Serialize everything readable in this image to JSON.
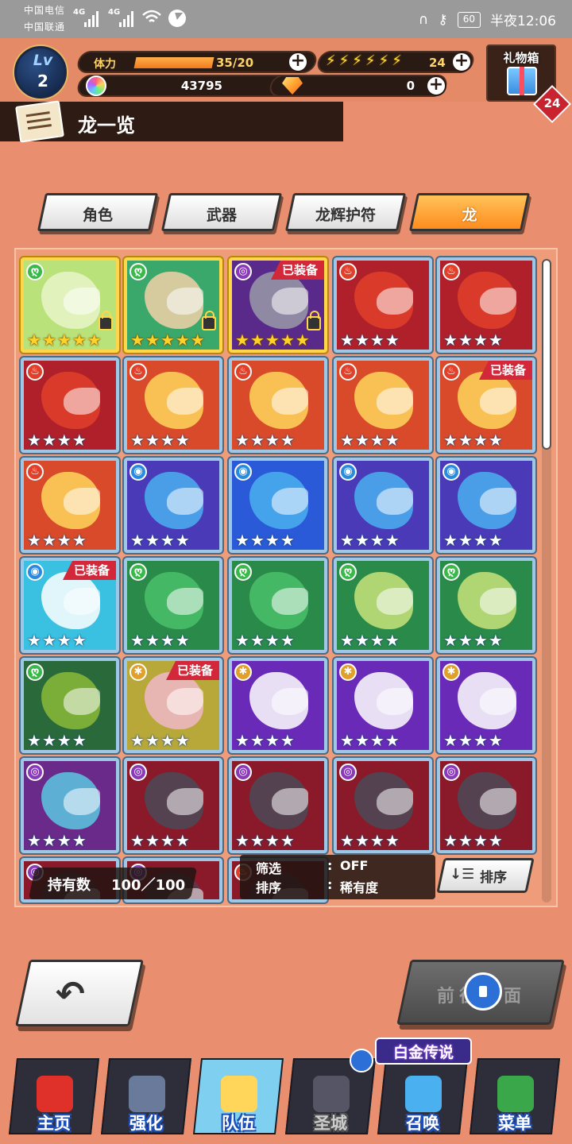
{
  "status_bar": {
    "carrier1": "中国电信",
    "carrier2": "中国联通",
    "net1": "4G",
    "net2": "4G",
    "battery": "60",
    "time": "半夜12:06"
  },
  "hud": {
    "level_label": "Lv",
    "level": "2",
    "stamina_label": "体力",
    "stamina": "35/20",
    "stamina_fill": 1.0,
    "bolts": [
      "⚡",
      "⚡",
      "⚡",
      "⚡",
      "⚡",
      "⚡"
    ],
    "bolt_count": "24",
    "gems": "43795",
    "crystals": "0",
    "gift_label": "礼物箱",
    "gift_count": "24"
  },
  "title": "龙一览",
  "tabs": [
    {
      "label": "角色",
      "active": false
    },
    {
      "label": "武器",
      "active": false
    },
    {
      "label": "龙辉护符",
      "active": false
    },
    {
      "label": "龙",
      "active": true
    }
  ],
  "grid": [
    {
      "element": "wind",
      "color": "#b9e27a",
      "art": "#e8f5c8",
      "stars": 5,
      "gold": true,
      "locked": true,
      "equipped": false
    },
    {
      "element": "wind",
      "color": "#3aa86a",
      "art": "#f1d1a8",
      "stars": 5,
      "gold": true,
      "locked": true,
      "equipped": false
    },
    {
      "element": "dark",
      "color": "#5a2a8a",
      "art": "#9a9aa8",
      "stars": 5,
      "gold": true,
      "locked": true,
      "equipped": true
    },
    {
      "element": "fire",
      "color": "#b0202a",
      "art": "#e0402a",
      "stars": 4,
      "gold": false,
      "locked": false,
      "equipped": false
    },
    {
      "element": "fire",
      "color": "#b0202a",
      "art": "#e0402a",
      "stars": 4,
      "gold": false,
      "locked": false,
      "equipped": false
    },
    {
      "element": "fire",
      "color": "#b0202a",
      "art": "#e0402a",
      "stars": 4,
      "gold": false,
      "locked": false,
      "equipped": false
    },
    {
      "element": "fire",
      "color": "#d84a2a",
      "art": "#ffd65a",
      "stars": 4,
      "gold": false,
      "locked": false,
      "equipped": false
    },
    {
      "element": "fire",
      "color": "#d84a2a",
      "art": "#ffd65a",
      "stars": 4,
      "gold": false,
      "locked": false,
      "equipped": false
    },
    {
      "element": "fire",
      "color": "#d84a2a",
      "art": "#ffd65a",
      "stars": 4,
      "gold": false,
      "locked": false,
      "equipped": false
    },
    {
      "element": "fire",
      "color": "#d84a2a",
      "art": "#ffd65a",
      "stars": 4,
      "gold": false,
      "locked": false,
      "equipped": true
    },
    {
      "element": "fire",
      "color": "#d84a2a",
      "art": "#ffd65a",
      "stars": 4,
      "gold": false,
      "locked": false,
      "equipped": false
    },
    {
      "element": "water",
      "color": "#4a3ab8",
      "art": "#4ab0f0",
      "stars": 4,
      "gold": false,
      "locked": false,
      "equipped": false
    },
    {
      "element": "water",
      "color": "#2a5ad8",
      "art": "#4ab0f0",
      "stars": 4,
      "gold": false,
      "locked": false,
      "equipped": false
    },
    {
      "element": "water",
      "color": "#4a3ab8",
      "art": "#4ab0f0",
      "stars": 4,
      "gold": false,
      "locked": false,
      "equipped": false
    },
    {
      "element": "water",
      "color": "#4a3ab8",
      "art": "#4ab0f0",
      "stars": 4,
      "gold": false,
      "locked": false,
      "equipped": false
    },
    {
      "element": "water",
      "color": "#3ac0e0",
      "art": "#ffffff",
      "stars": 4,
      "gold": false,
      "locked": false,
      "equipped": true
    },
    {
      "element": "wind",
      "color": "#2a8a4a",
      "art": "#4ac06a",
      "stars": 4,
      "gold": false,
      "locked": false,
      "equipped": false
    },
    {
      "element": "wind",
      "color": "#2a8a4a",
      "art": "#4ac06a",
      "stars": 4,
      "gold": false,
      "locked": false,
      "equipped": false
    },
    {
      "element": "wind",
      "color": "#2a8a4a",
      "art": "#c8e27a",
      "stars": 4,
      "gold": false,
      "locked": false,
      "equipped": false
    },
    {
      "element": "wind",
      "color": "#2a8a4a",
      "art": "#c8e27a",
      "stars": 4,
      "gold": false,
      "locked": false,
      "equipped": false
    },
    {
      "element": "wind",
      "color": "#2a6a3a",
      "art": "#8ab83a",
      "stars": 4,
      "gold": false,
      "locked": false,
      "equipped": false
    },
    {
      "element": "light",
      "color": "#b8a83a",
      "art": "#f0b8c8",
      "stars": 4,
      "gold": false,
      "locked": false,
      "equipped": true
    },
    {
      "element": "light",
      "color": "#6a2ab8",
      "art": "#ffffff",
      "stars": 4,
      "gold": false,
      "locked": false,
      "equipped": false
    },
    {
      "element": "light",
      "color": "#6a2ab8",
      "art": "#ffffff",
      "stars": 4,
      "gold": false,
      "locked": false,
      "equipped": false
    },
    {
      "element": "light",
      "color": "#6a2ab8",
      "art": "#ffffff",
      "stars": 4,
      "gold": false,
      "locked": false,
      "equipped": false
    },
    {
      "element": "dark",
      "color": "#6a2a8a",
      "art": "#5ac8e0",
      "stars": 4,
      "gold": false,
      "locked": false,
      "equipped": false
    },
    {
      "element": "dark",
      "color": "#8a1a2a",
      "art": "#4a4a58",
      "stars": 4,
      "gold": false,
      "locked": false,
      "equipped": false
    },
    {
      "element": "dark",
      "color": "#8a1a2a",
      "art": "#4a4a58",
      "stars": 4,
      "gold": false,
      "locked": false,
      "equipped": false
    },
    {
      "element": "dark",
      "color": "#8a1a2a",
      "art": "#4a4a58",
      "stars": 4,
      "gold": false,
      "locked": false,
      "equipped": false
    },
    {
      "element": "dark",
      "color": "#8a1a2a",
      "art": "#4a4a58",
      "stars": 4,
      "gold": false,
      "locked": false,
      "equipped": false
    },
    {
      "element": "dark",
      "color": "#8a1a2a",
      "art": "#5a3a4a",
      "stars": 0,
      "gold": false,
      "locked": false,
      "equipped": false
    },
    {
      "element": "dark",
      "color": "#8a1a2a",
      "art": "#5a3a4a",
      "stars": 0,
      "gold": false,
      "locked": false,
      "equipped": false
    },
    {
      "element": "fire",
      "color": "#8a1a2a",
      "art": "#5a3a4a",
      "stars": 0,
      "gold": false,
      "locked": false,
      "equipped": false
    }
  ],
  "equip_tag": "已装备",
  "element_glyphs": {
    "wind": "ღ",
    "fire": "♨",
    "water": "◉",
    "dark": "◎",
    "light": "✱"
  },
  "element_colors": {
    "wind": "#3ab84a",
    "fire": "#e0402a",
    "water": "#2a8ae0",
    "dark": "#8a3ab8",
    "light": "#e0a02a"
  },
  "footer": {
    "hold_label": "持有数",
    "hold_value": "100／100",
    "filter_label": "筛选",
    "filter_value": "OFF",
    "sort_row_label": "排序",
    "sort_row_value": "稀有度",
    "sort_button": "排序",
    "colon": ":"
  },
  "actions": {
    "back_arrow": "↶",
    "goto_label": "前往页面"
  },
  "nav": [
    {
      "label": "主页",
      "icon_color": "#e0302a"
    },
    {
      "label": "强化",
      "icon_color": "#6a7a9a"
    },
    {
      "label": "队伍",
      "icon_color": "#ffd65a"
    },
    {
      "label": "圣城",
      "icon_color": "#555566"
    },
    {
      "label": "召唤",
      "icon_color": "#4ab0f0"
    },
    {
      "label": "菜单",
      "icon_color": "#3aa84a"
    }
  ],
  "platinum_label": "白金传说"
}
